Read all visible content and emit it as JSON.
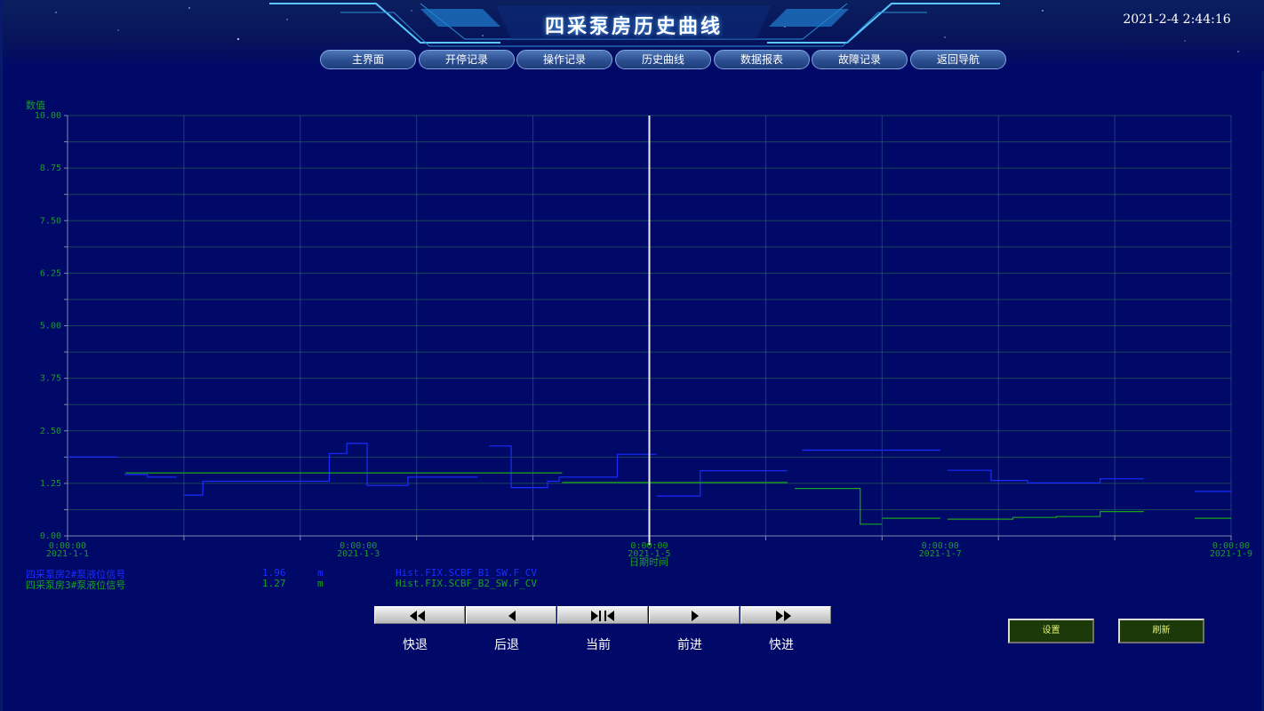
{
  "header": {
    "title": "四采泵房历史曲线",
    "clock": "2021-2-4 2:44:16"
  },
  "nav": [
    {
      "label": "主界面"
    },
    {
      "label": "开停记录"
    },
    {
      "label": "操作记录"
    },
    {
      "label": "历史曲线"
    },
    {
      "label": "数据报表"
    },
    {
      "label": "故障记录"
    },
    {
      "label": "返回导航"
    }
  ],
  "chart_data": {
    "type": "line",
    "ylabel": "数值",
    "xlabel": "日期时间",
    "ylim": [
      0,
      10
    ],
    "xlim": [
      0,
      8
    ],
    "y_ticks": [
      "0.00",
      "1.25",
      "2.50",
      "3.75",
      "5.00",
      "6.25",
      "7.50",
      "8.75",
      "10.00"
    ],
    "x_ticks": [
      {
        "time": "0:00:00",
        "date": "2021-1-1"
      },
      {
        "time": "0:00:00",
        "date": "2021-1-3"
      },
      {
        "time": "0:00:00",
        "date": "2021-1-5"
      },
      {
        "time": "0:00:00",
        "date": "2021-1-7"
      },
      {
        "time": "0:00:00",
        "date": "2021-1-9"
      }
    ],
    "cursor_x": 4.0,
    "grid": true,
    "series": [
      {
        "name": "四采泵房2#泵液位信号",
        "color": "#1a2cff",
        "segments": [
          [
            [
              0.0,
              1.88
            ],
            [
              0.34,
              1.88
            ]
          ],
          [
            [
              0.39,
              1.46
            ],
            [
              0.55,
              1.46
            ],
            [
              0.55,
              1.4
            ],
            [
              0.75,
              1.4
            ]
          ],
          [
            [
              0.8,
              0.97
            ],
            [
              0.93,
              0.97
            ],
            [
              0.93,
              1.3
            ],
            [
              1.8,
              1.3
            ],
            [
              1.8,
              1.96
            ],
            [
              1.92,
              1.96
            ],
            [
              1.92,
              2.2
            ],
            [
              2.06,
              2.2
            ],
            [
              2.06,
              1.2
            ],
            [
              2.34,
              1.2
            ],
            [
              2.34,
              1.4
            ],
            [
              2.82,
              1.4
            ]
          ],
          [
            [
              2.9,
              2.14
            ],
            [
              3.05,
              2.14
            ],
            [
              3.05,
              1.15
            ],
            [
              3.3,
              1.15
            ],
            [
              3.3,
              1.3
            ],
            [
              3.38,
              1.3
            ],
            [
              3.38,
              1.4
            ],
            [
              3.78,
              1.4
            ],
            [
              3.78,
              1.94
            ],
            [
              4.05,
              1.94
            ]
          ],
          [
            [
              4.05,
              0.95
            ],
            [
              4.35,
              0.95
            ],
            [
              4.35,
              1.55
            ],
            [
              4.95,
              1.55
            ]
          ],
          [
            [
              5.05,
              2.04
            ],
            [
              6.0,
              2.04
            ]
          ],
          [
            [
              6.05,
              1.56
            ],
            [
              6.35,
              1.56
            ],
            [
              6.35,
              1.32
            ],
            [
              6.6,
              1.32
            ],
            [
              6.6,
              1.26
            ],
            [
              7.1,
              1.26
            ],
            [
              7.1,
              1.36
            ],
            [
              7.4,
              1.36
            ]
          ],
          [
            [
              7.75,
              1.06
            ],
            [
              8.0,
              1.06
            ]
          ]
        ]
      },
      {
        "name": "四采泵房3#泵液位信号",
        "color": "#17a41c",
        "segments": [
          [
            [
              0.4,
              1.5
            ],
            [
              3.4,
              1.5
            ]
          ],
          [
            [
              3.4,
              1.27
            ],
            [
              4.95,
              1.27
            ]
          ],
          [
            [
              5.0,
              1.13
            ],
            [
              5.45,
              1.13
            ],
            [
              5.45,
              0.28
            ],
            [
              5.6,
              0.28
            ]
          ],
          [
            [
              5.6,
              0.42
            ],
            [
              6.0,
              0.42
            ]
          ],
          [
            [
              6.05,
              0.4
            ],
            [
              6.5,
              0.4
            ],
            [
              6.5,
              0.44
            ],
            [
              6.8,
              0.44
            ],
            [
              6.8,
              0.46
            ],
            [
              7.1,
              0.46
            ],
            [
              7.1,
              0.58
            ],
            [
              7.4,
              0.58
            ]
          ],
          [
            [
              7.75,
              0.42
            ],
            [
              8.0,
              0.42
            ]
          ]
        ]
      }
    ]
  },
  "legend": [
    {
      "name": "四采泵房2#泵液位信号",
      "value": "1.96",
      "unit": "m",
      "tag": "Hist.FIX.SCBF_B1_SW.F_CV",
      "color": "#1a2cff"
    },
    {
      "name": "四采泵房3#泵液位信号",
      "value": "1.27",
      "unit": "m",
      "tag": "Hist.FIX.SCBF_B2_SW.F_CV",
      "color": "#17a41c"
    }
  ],
  "playback": {
    "buttons": [
      {
        "label": "快退",
        "icon": "fast-rewind-icon"
      },
      {
        "label": "后退",
        "icon": "step-back-icon"
      },
      {
        "label": "当前",
        "icon": "current-icon"
      },
      {
        "label": "前进",
        "icon": "step-forward-icon"
      },
      {
        "label": "快进",
        "icon": "fast-forward-icon"
      }
    ]
  },
  "actions": {
    "settings_label": "设置",
    "refresh_label": "刷新"
  }
}
